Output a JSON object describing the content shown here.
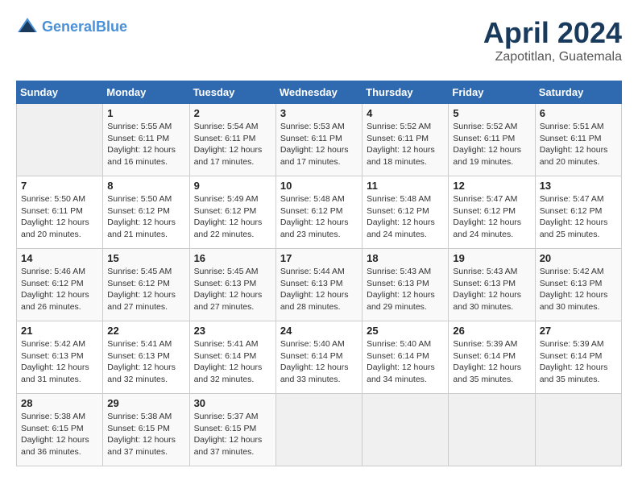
{
  "header": {
    "logo_line1": "General",
    "logo_line2": "Blue",
    "title": "April 2024",
    "subtitle": "Zapotitlan, Guatemala"
  },
  "calendar": {
    "days_of_week": [
      "Sunday",
      "Monday",
      "Tuesday",
      "Wednesday",
      "Thursday",
      "Friday",
      "Saturday"
    ],
    "weeks": [
      [
        {
          "day": "",
          "info": ""
        },
        {
          "day": "1",
          "info": "Sunrise: 5:55 AM\nSunset: 6:11 PM\nDaylight: 12 hours\nand 16 minutes."
        },
        {
          "day": "2",
          "info": "Sunrise: 5:54 AM\nSunset: 6:11 PM\nDaylight: 12 hours\nand 17 minutes."
        },
        {
          "day": "3",
          "info": "Sunrise: 5:53 AM\nSunset: 6:11 PM\nDaylight: 12 hours\nand 17 minutes."
        },
        {
          "day": "4",
          "info": "Sunrise: 5:52 AM\nSunset: 6:11 PM\nDaylight: 12 hours\nand 18 minutes."
        },
        {
          "day": "5",
          "info": "Sunrise: 5:52 AM\nSunset: 6:11 PM\nDaylight: 12 hours\nand 19 minutes."
        },
        {
          "day": "6",
          "info": "Sunrise: 5:51 AM\nSunset: 6:11 PM\nDaylight: 12 hours\nand 20 minutes."
        }
      ],
      [
        {
          "day": "7",
          "info": "Sunrise: 5:50 AM\nSunset: 6:11 PM\nDaylight: 12 hours\nand 20 minutes."
        },
        {
          "day": "8",
          "info": "Sunrise: 5:50 AM\nSunset: 6:12 PM\nDaylight: 12 hours\nand 21 minutes."
        },
        {
          "day": "9",
          "info": "Sunrise: 5:49 AM\nSunset: 6:12 PM\nDaylight: 12 hours\nand 22 minutes."
        },
        {
          "day": "10",
          "info": "Sunrise: 5:48 AM\nSunset: 6:12 PM\nDaylight: 12 hours\nand 23 minutes."
        },
        {
          "day": "11",
          "info": "Sunrise: 5:48 AM\nSunset: 6:12 PM\nDaylight: 12 hours\nand 24 minutes."
        },
        {
          "day": "12",
          "info": "Sunrise: 5:47 AM\nSunset: 6:12 PM\nDaylight: 12 hours\nand 24 minutes."
        },
        {
          "day": "13",
          "info": "Sunrise: 5:47 AM\nSunset: 6:12 PM\nDaylight: 12 hours\nand 25 minutes."
        }
      ],
      [
        {
          "day": "14",
          "info": "Sunrise: 5:46 AM\nSunset: 6:12 PM\nDaylight: 12 hours\nand 26 minutes."
        },
        {
          "day": "15",
          "info": "Sunrise: 5:45 AM\nSunset: 6:12 PM\nDaylight: 12 hours\nand 27 minutes."
        },
        {
          "day": "16",
          "info": "Sunrise: 5:45 AM\nSunset: 6:13 PM\nDaylight: 12 hours\nand 27 minutes."
        },
        {
          "day": "17",
          "info": "Sunrise: 5:44 AM\nSunset: 6:13 PM\nDaylight: 12 hours\nand 28 minutes."
        },
        {
          "day": "18",
          "info": "Sunrise: 5:43 AM\nSunset: 6:13 PM\nDaylight: 12 hours\nand 29 minutes."
        },
        {
          "day": "19",
          "info": "Sunrise: 5:43 AM\nSunset: 6:13 PM\nDaylight: 12 hours\nand 30 minutes."
        },
        {
          "day": "20",
          "info": "Sunrise: 5:42 AM\nSunset: 6:13 PM\nDaylight: 12 hours\nand 30 minutes."
        }
      ],
      [
        {
          "day": "21",
          "info": "Sunrise: 5:42 AM\nSunset: 6:13 PM\nDaylight: 12 hours\nand 31 minutes."
        },
        {
          "day": "22",
          "info": "Sunrise: 5:41 AM\nSunset: 6:13 PM\nDaylight: 12 hours\nand 32 minutes."
        },
        {
          "day": "23",
          "info": "Sunrise: 5:41 AM\nSunset: 6:14 PM\nDaylight: 12 hours\nand 32 minutes."
        },
        {
          "day": "24",
          "info": "Sunrise: 5:40 AM\nSunset: 6:14 PM\nDaylight: 12 hours\nand 33 minutes."
        },
        {
          "day": "25",
          "info": "Sunrise: 5:40 AM\nSunset: 6:14 PM\nDaylight: 12 hours\nand 34 minutes."
        },
        {
          "day": "26",
          "info": "Sunrise: 5:39 AM\nSunset: 6:14 PM\nDaylight: 12 hours\nand 35 minutes."
        },
        {
          "day": "27",
          "info": "Sunrise: 5:39 AM\nSunset: 6:14 PM\nDaylight: 12 hours\nand 35 minutes."
        }
      ],
      [
        {
          "day": "28",
          "info": "Sunrise: 5:38 AM\nSunset: 6:15 PM\nDaylight: 12 hours\nand 36 minutes."
        },
        {
          "day": "29",
          "info": "Sunrise: 5:38 AM\nSunset: 6:15 PM\nDaylight: 12 hours\nand 37 minutes."
        },
        {
          "day": "30",
          "info": "Sunrise: 5:37 AM\nSunset: 6:15 PM\nDaylight: 12 hours\nand 37 minutes."
        },
        {
          "day": "",
          "info": ""
        },
        {
          "day": "",
          "info": ""
        },
        {
          "day": "",
          "info": ""
        },
        {
          "day": "",
          "info": ""
        }
      ]
    ]
  }
}
